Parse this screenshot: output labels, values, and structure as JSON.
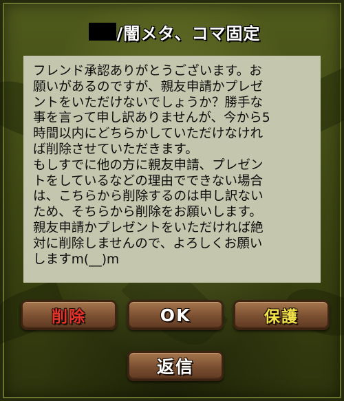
{
  "dialog": {
    "title": "/闇メタ、コマ固定",
    "message": "フレンド承認ありがとうございます。お\n願いがあるのですが、親友申請かプレゼ\nントをいただけないでしょうか？勝手な\n事を言って申し訳ありませんが、今から5\n時間以内にどちらかしていただけなけれ\nば削除させていただきます。\nもしすでに他の方に親友申請、プレゼン\nトをしているなどの理由でできない場合\nは、こちらから削除するのは申し訳ない\nため、そちらから削除をお願いします。\n親友申請かプレゼントをいただければ絶\n対に削除しませんので、よろしくお願い\nしますm(__)m"
  },
  "buttons": {
    "delete_label": "削除",
    "ok_label": "OK",
    "protect_label": "保護",
    "reply_label": "返信"
  },
  "colors": {
    "delete": "#e8322a",
    "ok": "#ffffff",
    "protect": "#f2e34a",
    "panel": "#c4c7ad",
    "background": "#4a5419"
  }
}
